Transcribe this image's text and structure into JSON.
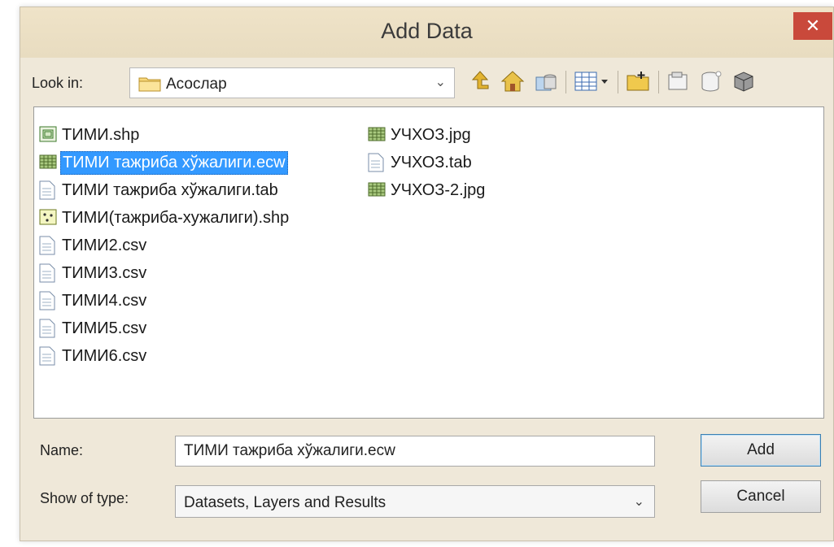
{
  "window": {
    "title": "Add Data",
    "close_glyph": "✕"
  },
  "look_in": {
    "label": "Look in:",
    "value": "Асослар",
    "icon": "folder-icon"
  },
  "toolbar": {
    "buttons": [
      {
        "name": "up-one-level-icon"
      },
      {
        "name": "home-icon"
      },
      {
        "name": "catalog-connect-icon"
      },
      {
        "name": "view-options-icon"
      },
      {
        "name": "new-folder-icon"
      },
      {
        "name": "new-layer-icon"
      },
      {
        "name": "new-table-icon"
      },
      {
        "name": "new-database-icon"
      }
    ]
  },
  "files": [
    {
      "label": "ТИМИ.shp",
      "icon": "polygon-shapefile-icon"
    },
    {
      "label": "ТИМИ тажриба хўжалиги.ecw",
      "icon": "raster-icon",
      "selected": true
    },
    {
      "label": "ТИМИ тажриба хўжалиги.tab",
      "icon": "file-icon"
    },
    {
      "label": "ТИМИ(тажриба-хужалиги).shp",
      "icon": "point-shapefile-icon"
    },
    {
      "label": "ТИМИ2.csv",
      "icon": "file-icon"
    },
    {
      "label": "ТИМИ3.csv",
      "icon": "file-icon"
    },
    {
      "label": "ТИМИ4.csv",
      "icon": "file-icon"
    },
    {
      "label": "ТИМИ5.csv",
      "icon": "file-icon"
    },
    {
      "label": "ТИМИ6.csv",
      "icon": "file-icon"
    },
    {
      "label": "УЧХОЗ.jpg",
      "icon": "raster-icon"
    },
    {
      "label": "УЧХОЗ.tab",
      "icon": "file-icon"
    },
    {
      "label": "УЧХОЗ-2.jpg",
      "icon": "raster-icon"
    }
  ],
  "name_field": {
    "label": "Name:",
    "value": "ТИМИ тажриба хўжалиги.ecw"
  },
  "type_field": {
    "label": "Show of type:",
    "value": "Datasets, Layers and Results"
  },
  "buttons": {
    "add": "Add",
    "cancel": "Cancel"
  },
  "colors": {
    "selection": "#3399ff",
    "close": "#c9493b",
    "dialog_bg": "#efe8d9"
  }
}
